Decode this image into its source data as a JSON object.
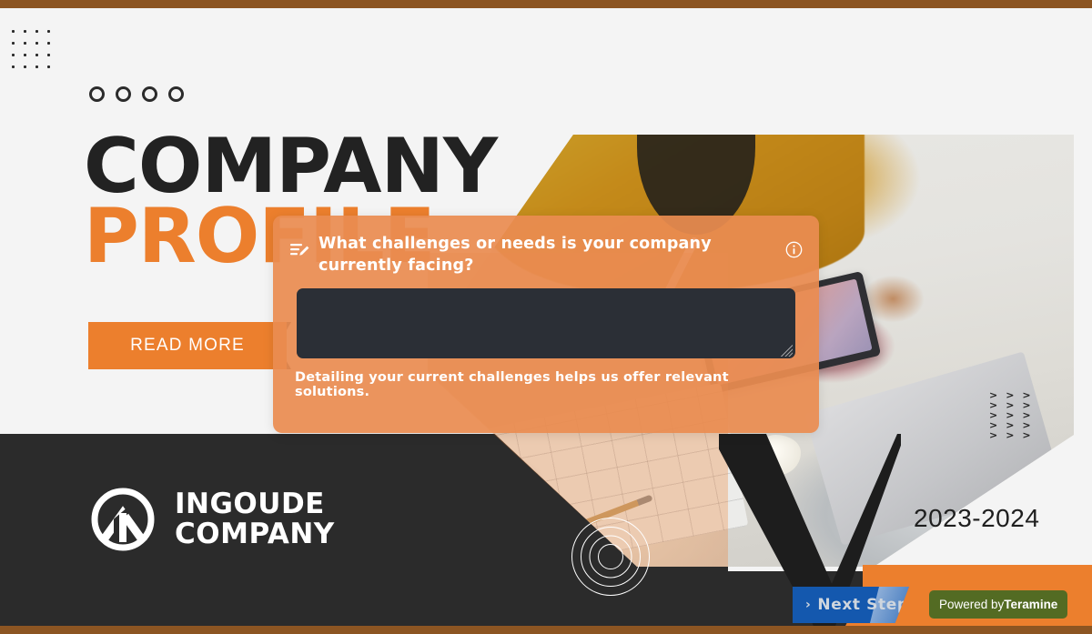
{
  "poster": {
    "headline_line1": "COMPANY",
    "headline_line2": "PROFILE",
    "read_more_label": "READ MORE",
    "brand_line1": "INGOUDE",
    "brand_line2": "COMPANY",
    "year_range": "2023-2024",
    "colors": {
      "accent_orange": "#ec7f2d",
      "panel_orange": "#ea8c51",
      "dark": "#2b2b2b",
      "frame_brown": "#8c5522",
      "light_bg": "#f4f4f4"
    },
    "decorations": {
      "dot_grid": "dot-grid-icon",
      "circles": "circle-row-icon",
      "chevrons": "chevron-grid-icon",
      "rings": "concentric-rings-icon"
    }
  },
  "question_panel": {
    "form_icon": "form-edit-icon",
    "question": "What challenges or needs is your company currently facing?",
    "info_icon": "info-circle-icon",
    "answer_value": "",
    "answer_placeholder": "",
    "hint": "Detailing your current challenges helps us offer relevant solutions."
  },
  "footer": {
    "next_step_label": "Next Step",
    "next_step_chevron": "chevron-right-icon",
    "powered_prefix": "Powered by",
    "powered_brand": "Teramine"
  }
}
